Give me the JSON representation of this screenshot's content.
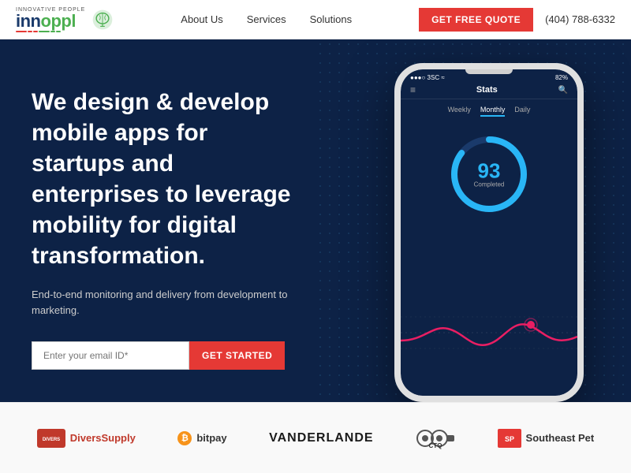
{
  "header": {
    "logo_innovative": "INNOVATIVE PEOPLE",
    "logo_name": "innoppl",
    "nav": {
      "about": "About Us",
      "services": "Services",
      "solutions": "Solutions"
    },
    "cta_button": "GET FREE QUOTE",
    "phone": "(404) 788-6332"
  },
  "hero": {
    "title": "We design & develop mobile apps for startups and enterprises to leverage mobility for digital transformation.",
    "subtitle": "End-to-end monitoring and delivery from development to marketing.",
    "email_placeholder": "Enter your email ID*",
    "cta_button": "GET STARTED"
  },
  "phone_mockup": {
    "carrier": "●●●○ 3SC ≈",
    "battery": "82%",
    "header_icon_left": "≡",
    "title": "Stats",
    "header_icon_right": "🔍",
    "tabs": [
      "Weekly",
      "Monthly",
      "Daily"
    ],
    "active_tab": "Monthly",
    "chart_number": "93",
    "chart_label": "Completed"
  },
  "clients": [
    {
      "name": "DiversSupply",
      "type": "divers"
    },
    {
      "name": "bitpay",
      "type": "bitpay"
    },
    {
      "name": "VANDERLANDE",
      "type": "vanderlande"
    },
    {
      "name": "CTQ",
      "type": "ctq"
    },
    {
      "name": "Southeast Pet",
      "type": "southeast"
    }
  ]
}
